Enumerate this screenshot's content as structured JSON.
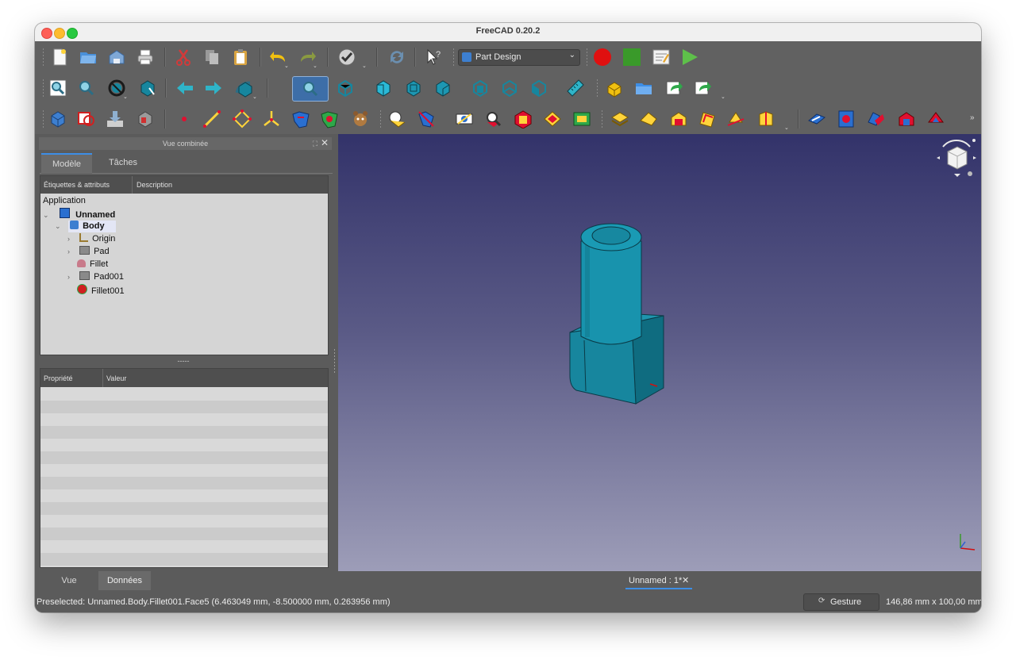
{
  "window": {
    "title": "FreeCAD 0.20.2"
  },
  "toolbar": {
    "workbench_selector": {
      "value": "Part Design"
    }
  },
  "combo_view": {
    "title": "Vue combinée",
    "tabs": [
      {
        "label": "Modèle",
        "active": true
      },
      {
        "label": "Tâches",
        "active": false
      }
    ]
  },
  "tree": {
    "columns": [
      "Étiquettes & attributs",
      "Description"
    ],
    "root": "Application",
    "items": [
      {
        "label": "Unnamed",
        "icon": "document-icon",
        "bold": true
      },
      {
        "label": "Body",
        "icon": "body-icon",
        "bold": true,
        "selected": true
      },
      {
        "label": "Origin",
        "icon": "origin-icon"
      },
      {
        "label": "Pad",
        "icon": "pad-icon"
      },
      {
        "label": "Fillet",
        "icon": "fillet-icon"
      },
      {
        "label": "Pad001",
        "icon": "pad-icon"
      },
      {
        "label": "Fillet001",
        "icon": "fillet-active-icon"
      }
    ]
  },
  "splitter": {
    "label": "-----"
  },
  "property_view": {
    "columns": [
      "Propriété",
      "Valeur"
    ]
  },
  "bottom_tabs": [
    {
      "label": "Vue",
      "active": false
    },
    {
      "label": "Données",
      "active": true
    }
  ],
  "document_tab": {
    "label": "Unnamed : 1*"
  },
  "status": {
    "preselection": "Preselected: Unnamed.Body.Fillet001.Face5 (6.463049 mm, -8.500000 mm, 0.263956 mm)",
    "navigation": "Gesture",
    "dimensions": "146,86 mm x 100,00 mm"
  },
  "colors": {
    "model": "#17869e",
    "model_dark": "#0f6c80",
    "accent_tab": "#3d8ee6",
    "viewport_top": "#33336a",
    "viewport_bottom": "#9d9db8",
    "record": "#e01010",
    "stop": "#3a9a2a",
    "play": "#5ec04a"
  }
}
